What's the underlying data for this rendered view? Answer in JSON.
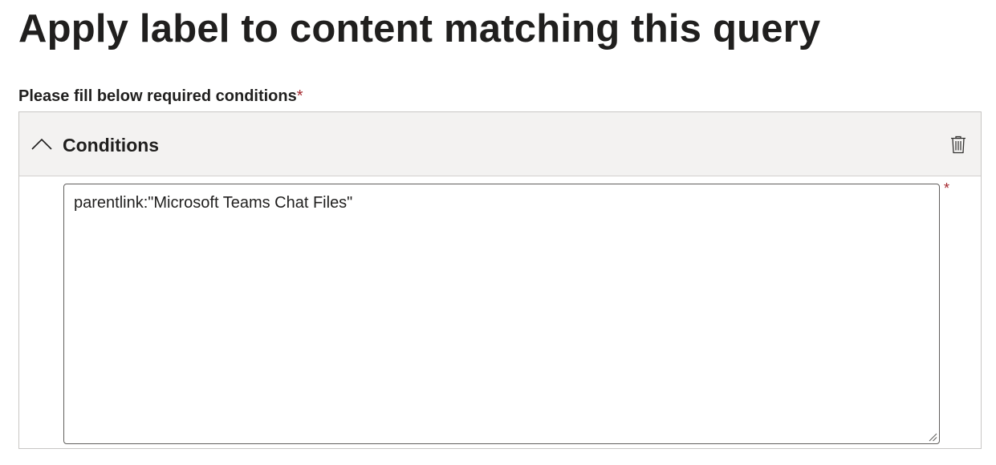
{
  "page": {
    "title": "Apply label to content matching this query"
  },
  "conditions": {
    "label": "Please fill below required conditions",
    "required_marker": "*"
  },
  "panel": {
    "title": "Conditions",
    "collapse_icon": "chevron-up-icon",
    "delete_icon": "trash-icon",
    "query_value": "parentlink:\"Microsoft Teams Chat Files\"",
    "required_marker": "*"
  },
  "colors": {
    "required": "#a4262c",
    "header_bg": "#f3f2f1",
    "text": "#201f1e",
    "border": "#c8c6c4"
  }
}
